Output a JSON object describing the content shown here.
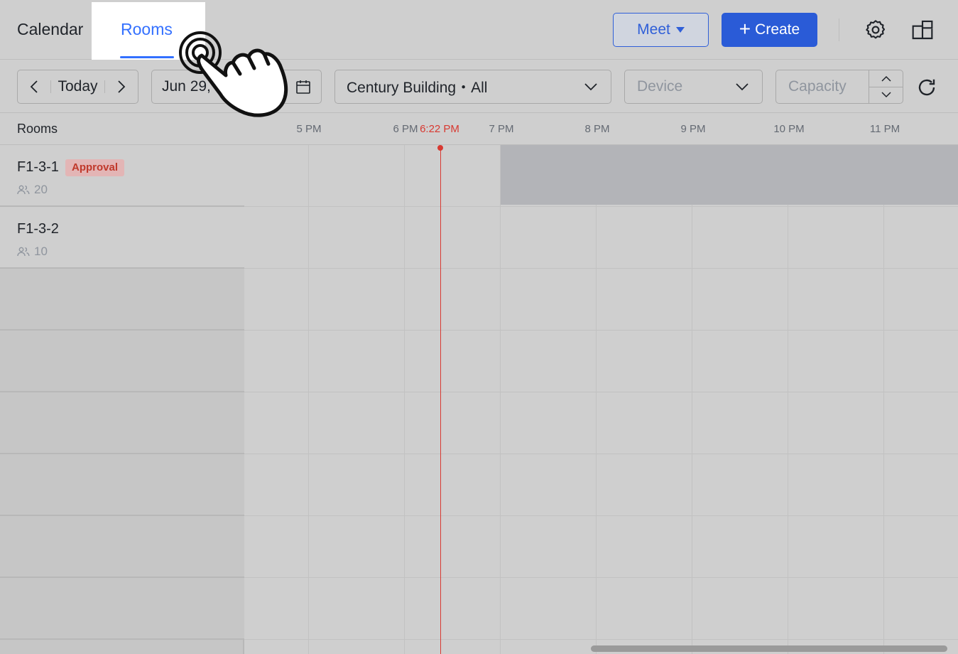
{
  "header": {
    "tabs": [
      {
        "label": "Calendar",
        "active": false
      },
      {
        "label": "Rooms",
        "active": true
      }
    ],
    "meet_label": "Meet",
    "create_label": "Create",
    "accent_color": "#3370ff"
  },
  "toolbar": {
    "today_label": "Today",
    "date_value": "Jun 29, 2",
    "building_value": "Century Building・All",
    "device_placeholder": "Device",
    "capacity_placeholder": "Capacity"
  },
  "grid": {
    "rooms_header": "Rooms",
    "time_ticks": [
      "5 PM",
      "6 PM",
      "7 PM",
      "8 PM",
      "9 PM",
      "10 PM",
      "11 PM"
    ],
    "now_label": "6:22 PM",
    "rooms": [
      {
        "name": "F1-3-1",
        "badge": "Approval",
        "capacity": "20"
      },
      {
        "name": "F1-3-2",
        "badge": "",
        "capacity": "10"
      }
    ]
  },
  "icons": [
    "chevron-left-icon",
    "chevron-right-icon",
    "calendar-icon",
    "chevron-down-icon",
    "gear-icon",
    "window-icon",
    "refresh-icon",
    "people-icon",
    "hand-pointer-icon"
  ]
}
